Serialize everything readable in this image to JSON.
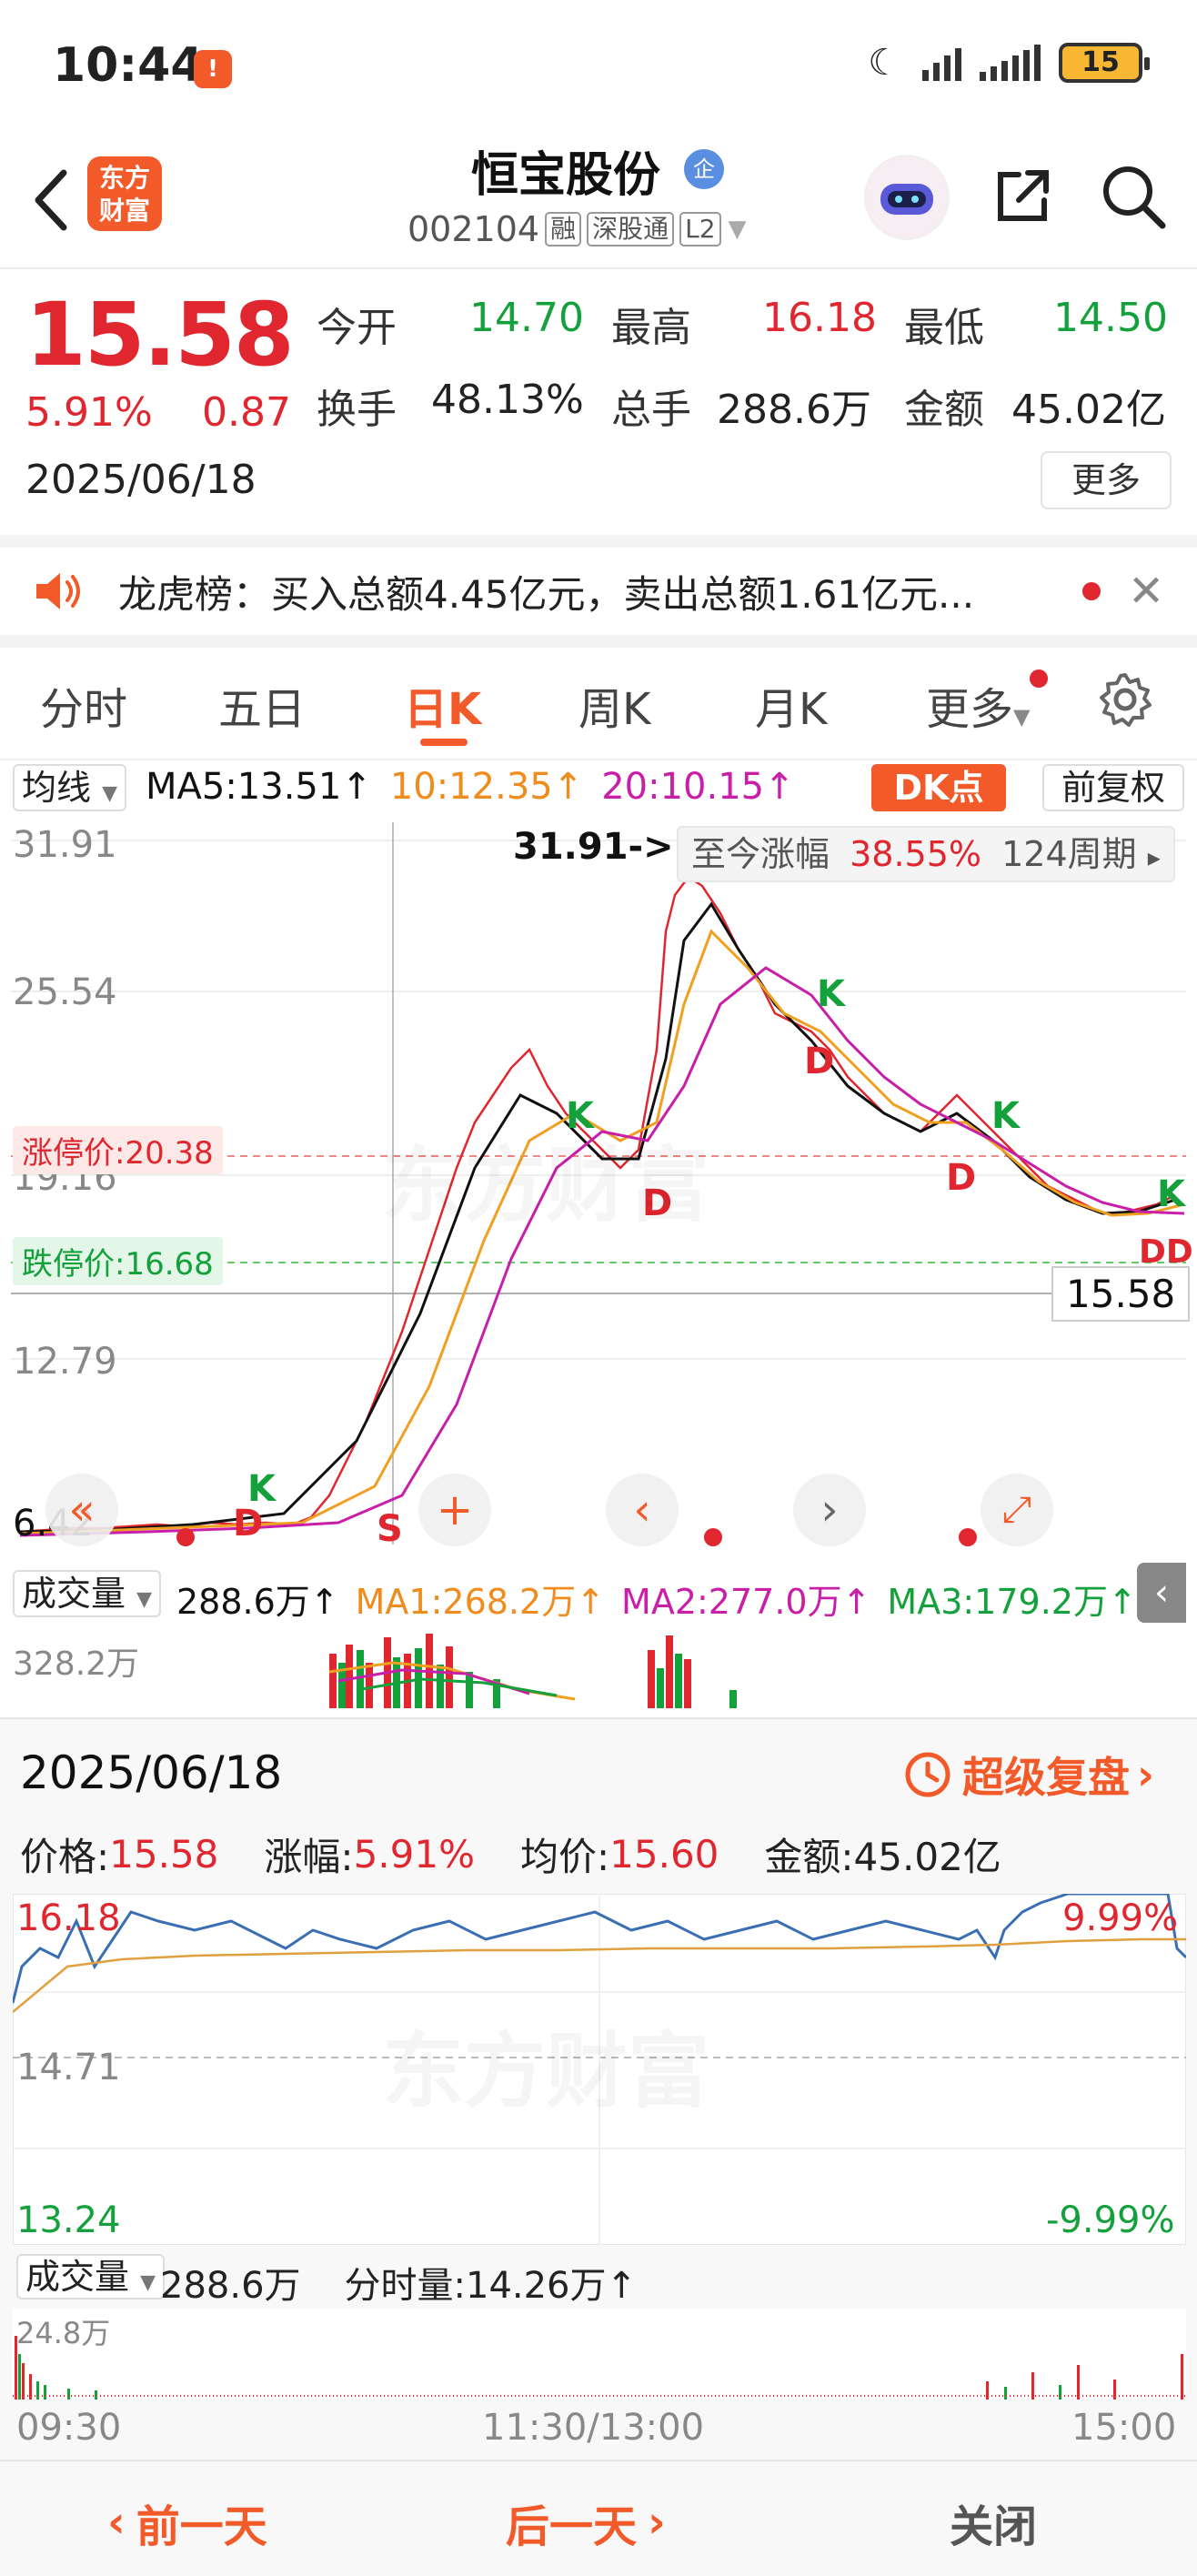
{
  "status_bar": {
    "time": "10:44",
    "battery": "15"
  },
  "header": {
    "logo_text": "东方财富",
    "stock_name": "恒宝股份",
    "corp_badge": "企",
    "code": "002104",
    "tags": [
      "融",
      "深股通",
      "L2"
    ]
  },
  "quote": {
    "price": "15.58",
    "change_pct": "5.91%",
    "change_amt": "0.87",
    "date": "2025/06/18",
    "fields": [
      {
        "label": "今开",
        "value": "14.70",
        "color": "#14a13c"
      },
      {
        "label": "最高",
        "value": "16.18",
        "color": "#e0262e"
      },
      {
        "label": "最低",
        "value": "14.50",
        "color": "#14a13c"
      },
      {
        "label": "换手",
        "value": "48.13%",
        "color": "#222222"
      },
      {
        "label": "总手",
        "value": "288.6万",
        "color": "#222222"
      },
      {
        "label": "金额",
        "value": "45.02亿",
        "color": "#222222"
      }
    ],
    "more_label": "更多"
  },
  "announcement": {
    "text": "龙虎榜：买入总额4.45亿元，卖出总额1.61亿元..."
  },
  "tabs": [
    "分时",
    "五日",
    "日K",
    "周K",
    "月K",
    "更多"
  ],
  "active_tab": "日K",
  "ma": {
    "select_label": "均线",
    "ma5": "MA5:13.51↑",
    "ma10": "10:12.35↑",
    "ma20": "20:10.15↑",
    "dk_label": "DK点",
    "adj_label": "前复权"
  },
  "kline": {
    "y_labels": [
      "31.91",
      "25.54",
      "19.16",
      "12.79",
      "6.42"
    ],
    "peak_label": "31.91->",
    "gain_label": "至今涨幅",
    "gain_value": "38.55%",
    "period_label": "124周期",
    "limit_up": "涨停价:20.38",
    "limit_down": "跌停价:16.68",
    "last_price": "15.58",
    "low_label": "6.42",
    "signals": [
      "K",
      "D",
      "S",
      "K",
      "D",
      "K",
      "D",
      "D",
      "K",
      "DD",
      "K"
    ]
  },
  "volume": {
    "select_label": "成交量",
    "total": "288.6万↑",
    "ma1": "MA1:268.2万↑",
    "ma2": "MA2:277.0万↑",
    "ma3": "MA3:179.2万↑",
    "max_label": "328.2万"
  },
  "panel": {
    "date": "2025/06/18",
    "replay_label": "超级复盘",
    "price_label": "价格:",
    "price_value": "15.58",
    "chg_label": "涨幅:",
    "chg_value": "5.91%",
    "avg_label": "均价:",
    "avg_value": "15.60",
    "amount_label": "金额:45.02亿",
    "intra_high": "16.18",
    "intra_mid": "14.71",
    "intra_low": "13.24",
    "intra_up_pct": "9.99%",
    "intra_down_pct": "-9.99%",
    "vol_select": "成交量",
    "vol_total": "288.6万",
    "vol_minute": "分时量:14.26万↑",
    "vol_max": "24.8万",
    "times": [
      "09:30",
      "11:30/13:00",
      "15:00"
    ]
  },
  "footer": {
    "prev_day": "前一天",
    "next_day": "后一天",
    "close": "关闭"
  },
  "watermark": "东方财富"
}
